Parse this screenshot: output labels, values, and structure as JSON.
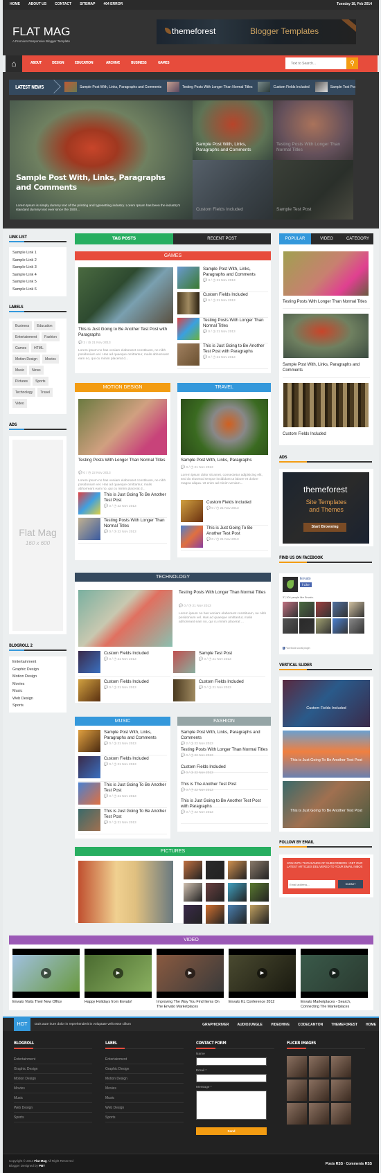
{
  "topbar": {
    "menu": [
      "HOME",
      "ABOUT US",
      "CONTACT",
      "SITEMAP",
      "404 ERROR"
    ],
    "date": "Tuesday 18, Feb 2014"
  },
  "header": {
    "logo": "FLAT MAG",
    "tagline": "A Premium Responsive Blogger Template",
    "banner_left": "themeforest",
    "banner_right": "Blogger Templates"
  },
  "nav": {
    "items": [
      "ABOUT",
      "DESIGN",
      "EDUCATION",
      "ARCHIVE",
      "BUSINESS",
      "GAMES"
    ],
    "search_placeholder": "Text to Search...",
    "accent": "#e74c3c"
  },
  "ticker": {
    "label": "LATEST NEWS",
    "items": [
      "Sample Post With, Links, Paragraphs and Comments",
      "Testing Posts With Longer Than Normal Titles",
      "Custom Fields Included",
      "Sample Test Post"
    ]
  },
  "hero": {
    "main_title": "Sample Post With, Links, Paragraphs and Comments",
    "main_excerpt": "Lorem Ipsum is simply dummy text of the printing and typesetting industry. Lorem Ipsum has been the industry's standard dummy text ever since the 1500...",
    "small": [
      "Sample Post With, Links, Paragraphs and Comments",
      "Testing Posts With Longer Than Normal Titles",
      "Custom Fields Included",
      "Sample Test Post"
    ]
  },
  "left": {
    "linklist_title": "LINK LIST",
    "links": [
      "Sample Link 1",
      "Sample Link 2",
      "Sample Link 3",
      "Sample Link 4",
      "Sample Link 5",
      "Sample Link 6"
    ],
    "labels_title": "LABELS",
    "labels": [
      "Business",
      "Education",
      "Entertainment",
      "Fashion",
      "Games",
      "HTML",
      "Motion Design",
      "Movies",
      "Music",
      "News",
      "Pictures",
      "Sports",
      "Technology",
      "Travel",
      "Video"
    ],
    "ads_title": "ADS",
    "ad_text": "Flat Mag",
    "ad_size": "160 x 600",
    "blogroll_title": "BLOGROLL 2",
    "blogroll": [
      "Entertainment",
      "Graphic Design",
      "Motion Design",
      "Movies",
      "Music",
      "Web Design",
      "Sports"
    ]
  },
  "center": {
    "tabs": [
      "TAG POSTS",
      "RECENT POST"
    ],
    "games": {
      "title": "GAMES",
      "main": {
        "title": "This is Just Going to Be Another Test Post with Paragraphs",
        "comments": "2",
        "date": "21 Nov 2013",
        "excerpt": "Lorem ipsum no has veniam elaboraret constituam, ne nibh posidonium vel. Has ad quaeque omittantur, malis abhorreant eam no, qui cu minim placerat d..."
      },
      "list": [
        {
          "title": "Sample Post With, Links, Paragraphs and Comments",
          "comments": "3",
          "date": "21 Nov 2013"
        },
        {
          "title": "Custom Fields Included",
          "comments": "0",
          "date": "21 Nov 2013"
        },
        {
          "title": "Testing Posts With Longer Than Normal Titles",
          "comments": "0",
          "date": "21 Nov 2013"
        },
        {
          "title": "This is Just Going to Be Another Test Post with Paragraphs",
          "comments": "0",
          "date": "21 Nov 2013"
        }
      ]
    },
    "motion": {
      "title": "MOTION DESIGN",
      "main": {
        "title": "Testing Posts With Longer Than Normal Titles",
        "comments": "0",
        "date": "22 Nov 2013",
        "excerpt": "Lorem ipsum no has veniam elaboraret constituam, ne nibh posidonium vel. Has ad quaeque omittantur, malis abhorreant eam no, qui cu minim placerat d..."
      },
      "list": [
        {
          "title": "This is Just Going To Be Another Test Post",
          "comments": "0",
          "date": "22 Nov 2013"
        },
        {
          "title": "Testing Posts With Longer Than Normal Titles",
          "comments": "0",
          "date": "22 Nov 2013"
        }
      ]
    },
    "travel": {
      "title": "TRAVEL",
      "main": {
        "title": "Sample Post With, Links, Paragraphs",
        "comments": "0",
        "date": "21 Nov 2013",
        "excerpt": "Lorem ipsum dolor sit amet, consectetur adipisicing elit, sed do eiusmod tempor incididunt ut labore et dolore magna aliqua. Ut enim ad minim veniam..."
      },
      "list": [
        {
          "title": "Custom Fields Included",
          "comments": "0",
          "date": "21 Nov 2013"
        },
        {
          "title": "This is Just Going To Be Another Test Post",
          "comments": "0",
          "date": "21 Nov 2013"
        }
      ]
    },
    "technology": {
      "title": "TECHNOLOGY",
      "main": {
        "title": "Testing Posts With Longer Than Normal Titles",
        "comments": "0",
        "date": "21 Nov 2013",
        "excerpt": "Lorem ipsum no has veniam elaboraret constituam, ne nibh posidonium vel. Has ad quaeque omittantur, malis abhorreant eam no, qui cu minim placerat ..."
      },
      "list": [
        {
          "title": "Custom Fields Included",
          "comments": "0",
          "date": "21 Nov 2013"
        },
        {
          "title": "Sample Test Post",
          "comments": "0",
          "date": "21 Nov 2013"
        },
        {
          "title": "Custom Fields Included",
          "comments": "0",
          "date": "21 Nov 2013"
        },
        {
          "title": "Custom Fields Included",
          "comments": "0",
          "date": "21 Nov 2013"
        }
      ]
    },
    "music": {
      "title": "MUSIC",
      "list": [
        {
          "title": "Sample Post With, Links, Paragraphs and Comments",
          "comments": "0",
          "date": "21 Nov 2013"
        },
        {
          "title": "Custom Fields Included",
          "comments": "0",
          "date": "21 Nov 2013"
        },
        {
          "title": "This is Just Going To Be Another Test Post",
          "comments": "0",
          "date": "21 Nov 2013"
        },
        {
          "title": "This is Just Going To Be Another Test Post",
          "comments": "0",
          "date": "21 Nov 2013"
        }
      ]
    },
    "fashion": {
      "title": "FASHION",
      "list": [
        {
          "title": "Sample Post With, Links, Paragraphs and Comments",
          "comments": "2",
          "date": "22 Nov 2013"
        },
        {
          "title": "Testing Posts With Longer Than Normal Titles",
          "comments": "0",
          "date": "22 Nov 2013"
        },
        {
          "title": "Custom Fields Included",
          "comments": "0",
          "date": "22 Nov 2013"
        },
        {
          "title": "This is The Another Test Post",
          "comments": "0",
          "date": "22 Nov 2013"
        },
        {
          "title": "This is Just Going to Be Another Test Post with Paragraphs",
          "comments": "0",
          "date": "22 Nov 2013"
        }
      ]
    },
    "pictures": {
      "title": "PICTURES"
    },
    "video": {
      "title": "VIDEO",
      "items": [
        "Envato Visits Their New Office",
        "Happy Holidays from Envato!",
        "Improving The Way You Find Items On The Envato Marketplaces",
        "Envato KL Conference 2012",
        "Envato Marketplaces - Search, Connecting The Marketplaces"
      ]
    }
  },
  "right": {
    "tabs": [
      "POPULAR",
      "VIDEO",
      "CATEGORY"
    ],
    "popular": [
      "Testing Posts With Longer Than Normal Titles",
      "Sample Post With, Links, Paragraphs and Comments",
      "Custom Fields Included"
    ],
    "ads_title": "ADS",
    "ad_brand": "themeforest",
    "ad_line1": "Site Templates",
    "ad_line2": "and Themes",
    "ad_button": "Start Browsing",
    "fb_title": "FIND US ON FACEBOOK",
    "fb_name": "Envato",
    "fb_like": "Like",
    "fb_count": "37,104 people like Envato.",
    "fb_plugin": "Facebook social plugin",
    "slider_title": "VERTICAL SLIDER",
    "slider": [
      "Custom Fields Included",
      "This is Just Going To Be Another Test Post",
      "This is Just Going To Be Another Test Post"
    ],
    "email_title": "FOLLOW BY EMAIL",
    "email_text": "JOIN WITH THOUSANDS OF SUBSCRIBERS ! GET OUR LATEST ARTICLES DELIVERED TO YOUR EMAIL INBOX",
    "email_placeholder": "Email address...",
    "email_submit": "SUBMIT"
  },
  "footer": {
    "hot_label": "HOT",
    "hot_text": "Duis aute irure dolor in reprehenderit in voluptate velit esse cillum",
    "links": [
      "GRAPHICRIVER",
      "AUDIOJUNGLE",
      "VIDEOHIVE",
      "CODECANYON",
      "THEMEFOREST",
      "HOME"
    ],
    "blogroll_title": "BLOGROLL",
    "label_title": "LABEL",
    "contact_title": "CONTACT FORM",
    "flickr_title": "FLICKR IMAGES",
    "list": [
      "Entertainment",
      "Graphic Design",
      "Motion Design",
      "Movies",
      "Music",
      "Web Design",
      "Sports"
    ],
    "name_label": "Name",
    "email_label": "Email *",
    "message_label": "Message *",
    "send": "Send",
    "copyright": "Copyright © 2014",
    "brand": "Flat Mag",
    "rights": "All Right Reserved",
    "designed": "Blogger Designed by",
    "designer": "PBT",
    "rss": "Posts RSS · Comments RSS"
  }
}
